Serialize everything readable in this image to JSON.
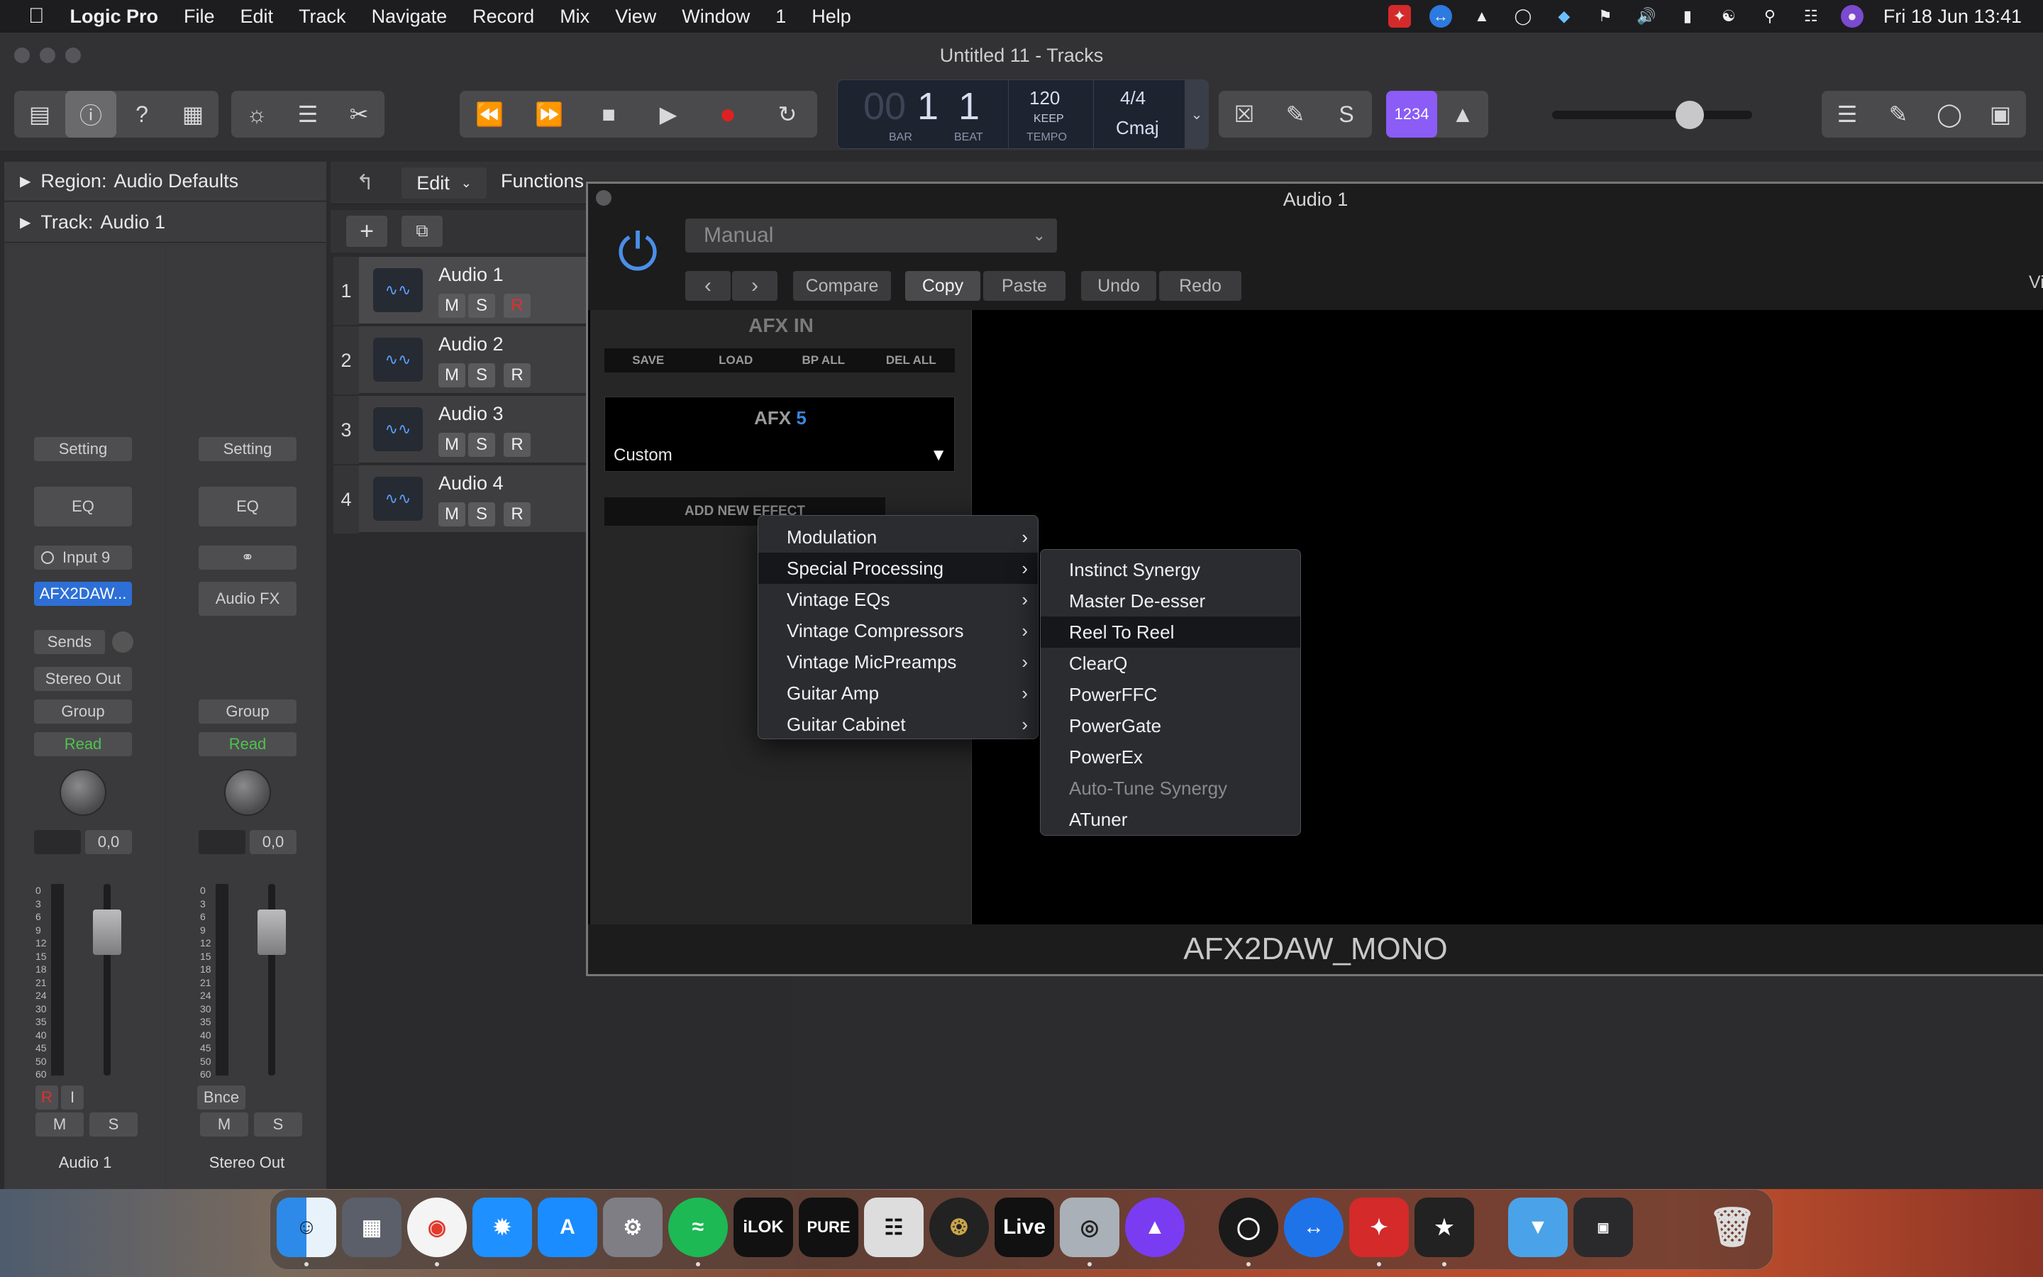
{
  "menubar": {
    "app": "Logic Pro",
    "items": [
      "File",
      "Edit",
      "Track",
      "Navigate",
      "Record",
      "Mix",
      "View",
      "Window",
      "1",
      "Help"
    ],
    "clock": "Fri 18 Jun  13:41"
  },
  "window": {
    "title": "Untitled 11 - Tracks"
  },
  "lcd": {
    "bar_dim": "00",
    "bar": "1",
    "beat": "1",
    "bar_label": "BAR",
    "beat_label": "BEAT",
    "tempo": "120",
    "keep": "KEEP",
    "tempo_label": "TEMPO",
    "sig": "4/4",
    "key": "Cmaj"
  },
  "toolbar": {
    "mode_label": "1234"
  },
  "inspector": {
    "region_label": "Region:",
    "region_value": "Audio Defaults",
    "track_label": "Track:",
    "track_value": "Audio 1"
  },
  "strips": [
    {
      "setting": "Setting",
      "eq": "EQ",
      "input": "Input 9",
      "plugin": "AFX2DAW...",
      "sends": "Sends",
      "output": "Stereo Out",
      "group": "Group",
      "auto": "Read",
      "vol": "0,0",
      "mute": "M",
      "solo": "S",
      "r": "R",
      "i": "I",
      "name": "Audio 1"
    },
    {
      "setting": "Setting",
      "eq": "EQ",
      "fx": "Audio FX",
      "group": "Group",
      "auto": "Read",
      "vol": "0,0",
      "bnce": "Bnce",
      "mute": "M",
      "solo": "S",
      "name": "Stereo Out"
    }
  ],
  "fader_scale": [
    "0",
    "3",
    "6",
    "9",
    "12",
    "15",
    "18",
    "21",
    "24",
    "30",
    "35",
    "40",
    "45",
    "50",
    "60"
  ],
  "tracks_bar": {
    "edit": "Edit",
    "functions": "Functions"
  },
  "tracks": [
    {
      "num": "1",
      "name": "Audio 1",
      "m": "M",
      "s": "S",
      "r": "R"
    },
    {
      "num": "2",
      "name": "Audio 2",
      "m": "M",
      "s": "S",
      "r": "R"
    },
    {
      "num": "3",
      "name": "Audio 3",
      "m": "M",
      "s": "S",
      "r": "R"
    },
    {
      "num": "4",
      "name": "Audio 4",
      "m": "M",
      "s": "S",
      "r": "R"
    }
  ],
  "plugin": {
    "title": "Audio 1",
    "preset": "Manual",
    "compare": "Compare",
    "copy": "Copy",
    "paste": "Paste",
    "undo": "Undo",
    "redo": "Redo",
    "view_partial": "Vi",
    "afx_in": "AFX IN",
    "afx_buttons": [
      "SAVE",
      "LOAD",
      "BP ALL",
      "DEL ALL"
    ],
    "afx_name": "AFX",
    "afx_num": "5",
    "afx_preset": "Custom",
    "add_effect": "ADD NEW EFFECT",
    "footer": "AFX2DAW_MONO"
  },
  "menu_main": [
    {
      "label": "Modulation"
    },
    {
      "label": "Special Processing"
    },
    {
      "label": "Vintage EQs"
    },
    {
      "label": "Vintage Compressors"
    },
    {
      "label": "Vintage MicPreamps"
    },
    {
      "label": "Guitar Amp"
    },
    {
      "label": "Guitar Cabinet"
    }
  ],
  "menu_sub": [
    {
      "label": "Instinct Synergy"
    },
    {
      "label": "Master De-esser"
    },
    {
      "label": "Reel To Reel"
    },
    {
      "label": "ClearQ"
    },
    {
      "label": "PowerFFC"
    },
    {
      "label": "PowerGate"
    },
    {
      "label": "PowerEx"
    },
    {
      "label": "Auto-Tune Synergy"
    },
    {
      "label": "ATuner"
    }
  ],
  "dock": {
    "live": "Live",
    "ilok": "iLOK",
    "pure": "PURE"
  },
  "colors": {
    "accent": "#4a8fe8",
    "record": "#e02020",
    "auto_read": "#4fc24f",
    "purple": "#8b5cf6"
  }
}
